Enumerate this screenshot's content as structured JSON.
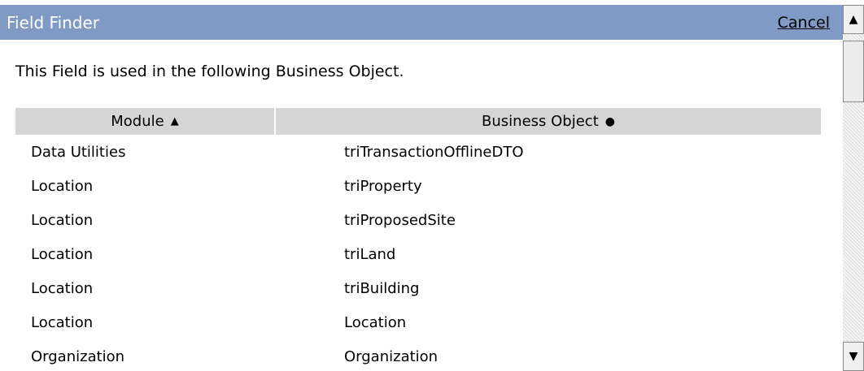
{
  "window": {
    "title": "Field Finder",
    "cancel_label": "Cancel"
  },
  "subtitle": "This Field is used in the following Business Object.",
  "table": {
    "columns": {
      "module": "Module",
      "business_object": "Business Object"
    },
    "sort": {
      "module_icon": "triangle-up-icon",
      "business_object_icon": "dot-icon"
    },
    "rows": [
      {
        "module": "Data Utilities",
        "business_object": "triTransactionOfflineDTO"
      },
      {
        "module": "Location",
        "business_object": "triProperty"
      },
      {
        "module": "Location",
        "business_object": "triProposedSite"
      },
      {
        "module": "Location",
        "business_object": "triLand"
      },
      {
        "module": "Location",
        "business_object": "triBuilding"
      },
      {
        "module": "Location",
        "business_object": "Location"
      },
      {
        "module": "Organization",
        "business_object": "Organization"
      }
    ]
  },
  "colors": {
    "title_bar": "#7f9bc5",
    "header_bg": "#d5d5d5"
  }
}
